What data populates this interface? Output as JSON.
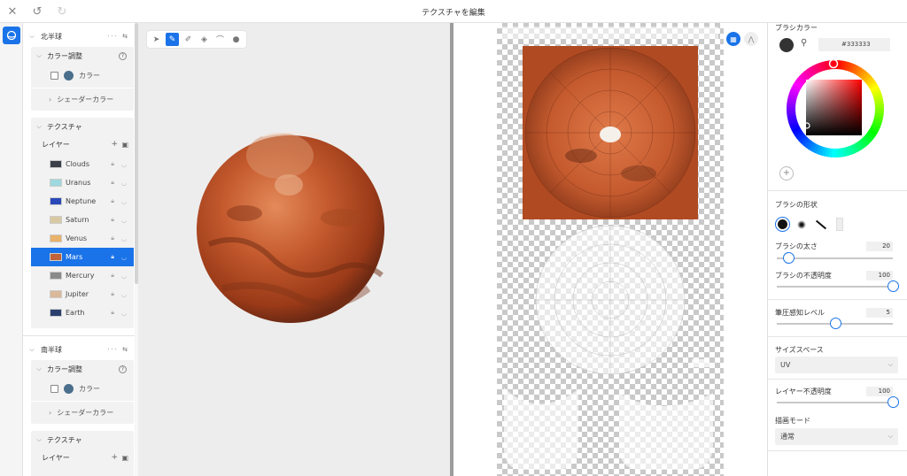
{
  "app": {
    "title": "テクスチャを編集"
  },
  "topbar": {
    "close_icon": "close-icon",
    "undo_icon": "undo-icon",
    "redo_icon": "redo-icon"
  },
  "left": {
    "north": {
      "header": "北半球",
      "color_adjust": {
        "label": "カラー調整",
        "color_label": "カラー",
        "color_value": "#4a6f8c",
        "shader_color": "シェーダーカラー"
      },
      "texture": {
        "label": "テクスチャ",
        "layers_label": "レイヤー",
        "layers": [
          {
            "name": "Clouds",
            "thumb": "#3a3f4a"
          },
          {
            "name": "Uranus",
            "thumb": "#9fd8de"
          },
          {
            "name": "Neptune",
            "thumb": "#2a49b8"
          },
          {
            "name": "Saturn",
            "thumb": "#d9c9a3"
          },
          {
            "name": "Venus",
            "thumb": "#e8b26a"
          },
          {
            "name": "Mars",
            "thumb": "#c0623a",
            "selected": true
          },
          {
            "name": "Mercury",
            "thumb": "#8a8a8a"
          },
          {
            "name": "Jupiter",
            "thumb": "#d9b99a"
          },
          {
            "name": "Earth",
            "thumb": "#2a3f6e"
          }
        ]
      }
    },
    "south": {
      "header": "南半球",
      "color_adjust": {
        "label": "カラー調整",
        "color_label": "カラー",
        "color_value": "#4a6f8c",
        "shader_color": "シェーダーカラー"
      },
      "texture": {
        "label": "テクスチャ",
        "layers_label": "レイヤー"
      }
    }
  },
  "viewport": {
    "tools": [
      "select-icon",
      "brush-icon",
      "eraser-icon",
      "fill-icon",
      "stamp-icon",
      "drop-icon"
    ],
    "active_tool": 1,
    "planet_colors": {
      "base": "#c45a2e",
      "light": "#e07a4a",
      "dark": "#6e2a14"
    }
  },
  "uv": {
    "mode_buttons": [
      "grid-icon",
      "mirror-icon"
    ],
    "active": 0
  },
  "right": {
    "brush_color": {
      "label": "ブラシカラー",
      "hex": "#333333",
      "swatch": "#333333",
      "hue_marker": "#ff0000"
    },
    "brush_shape": {
      "label": "ブラシの形状"
    },
    "brush_size": {
      "label": "ブラシの太さ",
      "value": "20",
      "level": 0.1
    },
    "brush_opacity": {
      "label": "ブラシの不透明度",
      "value": "100",
      "level": 1.0
    },
    "pressure": {
      "label": "筆圧感知レベル",
      "value": "5",
      "level": 0.5
    },
    "size_space": {
      "label": "サイズスペース",
      "value": "UV"
    },
    "layer_opacity": {
      "label": "レイヤー不透明度",
      "value": "100",
      "level": 1.0
    },
    "draw_mode": {
      "label": "描画モード",
      "value": "通常"
    },
    "accent": "#1a73e8"
  }
}
